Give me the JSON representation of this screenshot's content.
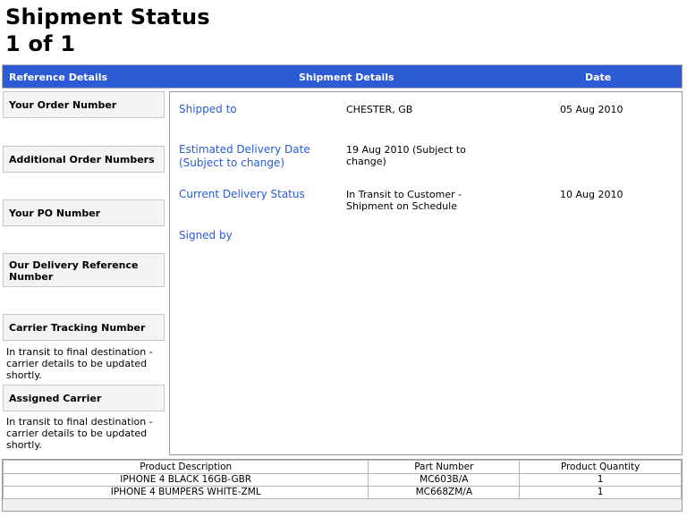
{
  "page": {
    "title_line1": "Shipment Status",
    "title_line2": "1 of 1"
  },
  "header": {
    "reference_details": "Reference Details",
    "shipment_details": "Shipment Details",
    "date": "Date",
    "color": "#2d5bd6"
  },
  "reference": {
    "order_number_label": "Your Order Number",
    "additional_order_numbers_label": "Additional Order Numbers",
    "po_number_label": "Your PO Number",
    "delivery_reference_label_1": "Our Delivery Reference",
    "delivery_reference_label_2": "Number",
    "carrier_tracking_label": "Carrier Tracking Number",
    "carrier_tracking_note_1": "In transit to final destination -",
    "carrier_tracking_note_2": "carrier details to be updated",
    "carrier_tracking_note_3": "shortly.",
    "assigned_carrier_label": "Assigned Carrier",
    "assigned_carrier_note_1": "In transit to final destination -",
    "assigned_carrier_note_2": "carrier details to be updated",
    "assigned_carrier_note_3": "shortly."
  },
  "details": {
    "shipped_to_label": "Shipped to",
    "shipped_to_value": "CHESTER, GB",
    "shipped_to_date": "05 Aug 2010",
    "estimated_label_1": "Estimated Delivery Date",
    "estimated_label_2": "(Subject to change)",
    "estimated_value_1": "19 Aug 2010 (Subject to",
    "estimated_value_2": "change)",
    "status_label": "Current Delivery Status",
    "status_value_1": "In Transit to Customer -",
    "status_value_2": "Shipment on Schedule",
    "status_date": "10 Aug 2010",
    "signed_by_label": "Signed by",
    "label_color": "#2a5bd0"
  },
  "products": {
    "headers": [
      "Product Description",
      "Part Number",
      "Product Quantity"
    ],
    "rows": [
      [
        "IPHONE 4 BLACK 16GB-GBR",
        "MC603B/A",
        "1"
      ],
      [
        "IPHONE 4 BUMPERS WHITE-ZML",
        "MC668ZM/A",
        "1"
      ]
    ]
  }
}
